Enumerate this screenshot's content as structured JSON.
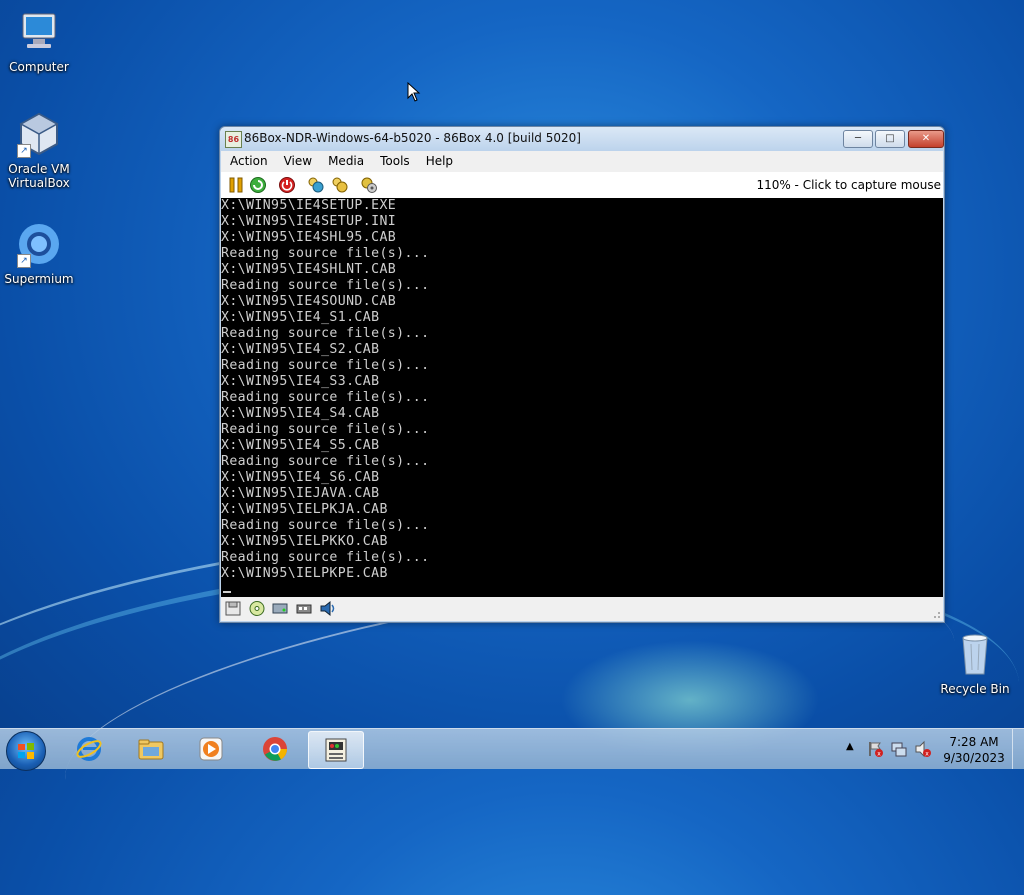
{
  "desktop": {
    "icons": [
      {
        "label": "Computer"
      },
      {
        "label": "Oracle VM\nVirtualBox"
      },
      {
        "label": "Supermium"
      },
      {
        "label": "Recycle Bin"
      }
    ]
  },
  "window": {
    "title": "86Box-NDR-Windows-64-b5020 - 86Box 4.0 [build 5020]",
    "menu": [
      "Action",
      "View",
      "Media",
      "Tools",
      "Help"
    ],
    "zoom_status": "110% - Click to capture mouse",
    "console_lines": [
      "X:\\WIN95\\IE4SETUP.EXE",
      "X:\\WIN95\\IE4SETUP.INI",
      "X:\\WIN95\\IE4SHL95.CAB",
      "Reading source file(s)...",
      "X:\\WIN95\\IE4SHLNT.CAB",
      "Reading source file(s)...",
      "X:\\WIN95\\IE4SOUND.CAB",
      "X:\\WIN95\\IE4_S1.CAB",
      "Reading source file(s)...",
      "X:\\WIN95\\IE4_S2.CAB",
      "Reading source file(s)...",
      "X:\\WIN95\\IE4_S3.CAB",
      "Reading source file(s)...",
      "X:\\WIN95\\IE4_S4.CAB",
      "Reading source file(s)...",
      "X:\\WIN95\\IE4_S5.CAB",
      "Reading source file(s)...",
      "X:\\WIN95\\IE4_S6.CAB",
      "X:\\WIN95\\IEJAVA.CAB",
      "X:\\WIN95\\IELPKJA.CAB",
      "Reading source file(s)...",
      "X:\\WIN95\\IELPKKO.CAB",
      "Reading source file(s)...",
      "X:\\WIN95\\IELPKPE.CAB"
    ]
  },
  "taskbar": {
    "time": "7:28 AM",
    "date": "9/30/2023"
  }
}
